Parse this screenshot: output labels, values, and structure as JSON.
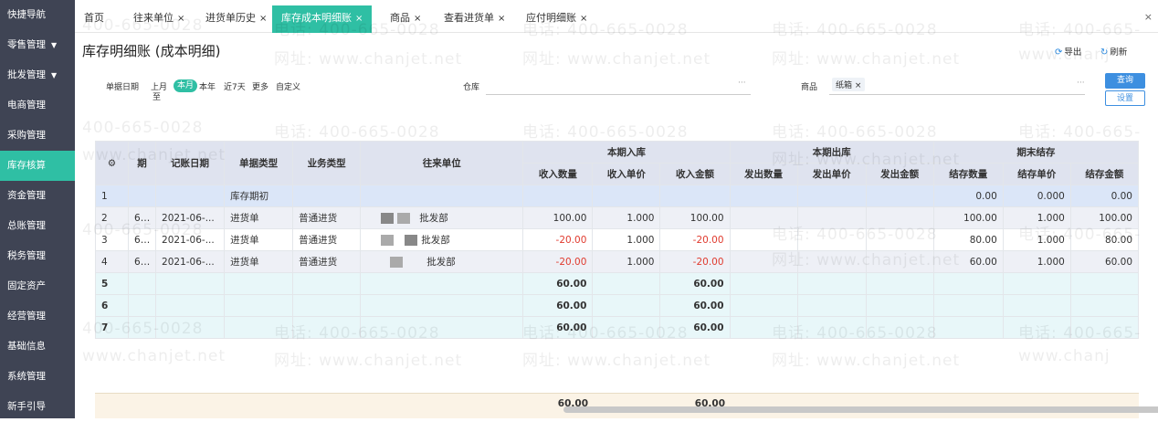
{
  "sidebar": {
    "items": [
      {
        "label": "快捷导航"
      },
      {
        "label": "零售管理",
        "arrow": "▼"
      },
      {
        "label": "批发管理",
        "arrow": "▼"
      },
      {
        "label": "电商管理"
      },
      {
        "label": "采购管理"
      },
      {
        "label": "库存核算"
      },
      {
        "label": "资金管理"
      },
      {
        "label": "总账管理"
      },
      {
        "label": "税务管理"
      },
      {
        "label": "固定资产"
      },
      {
        "label": "经营管理"
      },
      {
        "label": "基础信息"
      },
      {
        "label": "系统管理"
      },
      {
        "label": "新手引导"
      }
    ],
    "active_index": 5
  },
  "tabs": [
    {
      "label": "首页",
      "close": ""
    },
    {
      "label": "往来单位",
      "close": "×"
    },
    {
      "label": "进货单历史",
      "close": "×"
    },
    {
      "label": "库存成本明细账",
      "close": "×"
    },
    {
      "label": "商品",
      "close": "×"
    },
    {
      "label": "查看进货单",
      "close": "×"
    },
    {
      "label": "应付明细账",
      "close": "×"
    }
  ],
  "tabs_close_all": "×",
  "page": {
    "title": "库存明细账 (成本明细)",
    "export_label": "导出",
    "refresh_label": "刷新",
    "export_icon": "export-icon",
    "refresh_icon": "refresh-icon"
  },
  "filter": {
    "date_label": "单据日期",
    "quick_dates": [
      "上月",
      "本月",
      "本年",
      "近7天",
      "更多",
      "自定义"
    ],
    "quick_dates_sub": "至",
    "selected_quick": "本月",
    "warehouse_label": "仓库",
    "warehouse_value": "",
    "product_label": "商品",
    "product_tag": "纸箱",
    "product_tag_close": "×",
    "more_dots": "···",
    "query_button": "查询",
    "settings_button": "设置"
  },
  "table": {
    "settings_icon": "gear-icon",
    "settings_glyph": "⚙",
    "headers": {
      "period": "期",
      "date": "记账日期",
      "doc_type": "单据类型",
      "biz_type": "业务类型",
      "partner": "往来单位",
      "in_group": "本期入库",
      "out_group": "本期出库",
      "end_group": "期末结存",
      "in_qty": "收入数量",
      "in_price": "收入单价",
      "in_amount": "收入金额",
      "out_qty": "发出数量",
      "out_price": "发出单价",
      "out_amount": "发出金额",
      "end_qty": "结存数量",
      "end_price": "结存单价",
      "end_amount": "结存金额"
    },
    "rows": [
      {
        "no": "1",
        "period": "",
        "date": "",
        "doc_type": "库存期初",
        "biz_type": "",
        "partner": "",
        "in_qty": "",
        "in_price": "",
        "in_amount": "",
        "out_qty": "",
        "out_price": "",
        "out_amount": "",
        "end_qty": "0.00",
        "end_price": "0.000",
        "end_amount": "0.00"
      },
      {
        "no": "2",
        "period": "6-...",
        "date": "2021-06-...",
        "doc_type": "进货单",
        "biz_type": "普通进货",
        "partner": "批发部",
        "in_qty": "100.00",
        "in_price": "1.000",
        "in_amount": "100.00",
        "out_qty": "",
        "out_price": "",
        "out_amount": "",
        "end_qty": "100.00",
        "end_price": "1.000",
        "end_amount": "100.00"
      },
      {
        "no": "3",
        "period": "6-...",
        "date": "2021-06-...",
        "doc_type": "进货单",
        "biz_type": "普通进货",
        "partner": "批发部",
        "in_qty": "-20.00",
        "in_price": "1.000",
        "in_amount": "-20.00",
        "out_qty": "",
        "out_price": "",
        "out_amount": "",
        "end_qty": "80.00",
        "end_price": "1.000",
        "end_amount": "80.00"
      },
      {
        "no": "4",
        "period": "6-...",
        "date": "2021-06-...",
        "doc_type": "进货单",
        "biz_type": "普通进货",
        "partner": "批发部",
        "in_qty": "-20.00",
        "in_price": "1.000",
        "in_amount": "-20.00",
        "out_qty": "",
        "out_price": "",
        "out_amount": "",
        "end_qty": "60.00",
        "end_price": "1.000",
        "end_amount": "60.00"
      },
      {
        "no": "5",
        "in_qty": "60.00",
        "in_amount": "60.00"
      },
      {
        "no": "6",
        "in_qty": "60.00",
        "in_amount": "60.00"
      },
      {
        "no": "7",
        "in_qty": "60.00",
        "in_amount": "60.00"
      }
    ],
    "footer": {
      "in_qty": "60.00",
      "in_amount": "60.00"
    }
  },
  "watermark": {
    "phone": "电话: 400-665-0028",
    "phone_short": "400-665-0028",
    "site": "网址: www.chanjet.net",
    "site_short": "www.chanjet.net",
    "site_cut": "www.chanj",
    "phone_cut": "电话: 400-665-"
  },
  "colors": {
    "accent": "#2fbfa4",
    "sidebar": "#3f4454",
    "negative": "#e03b2f",
    "primary_btn": "#3d8fe0"
  }
}
